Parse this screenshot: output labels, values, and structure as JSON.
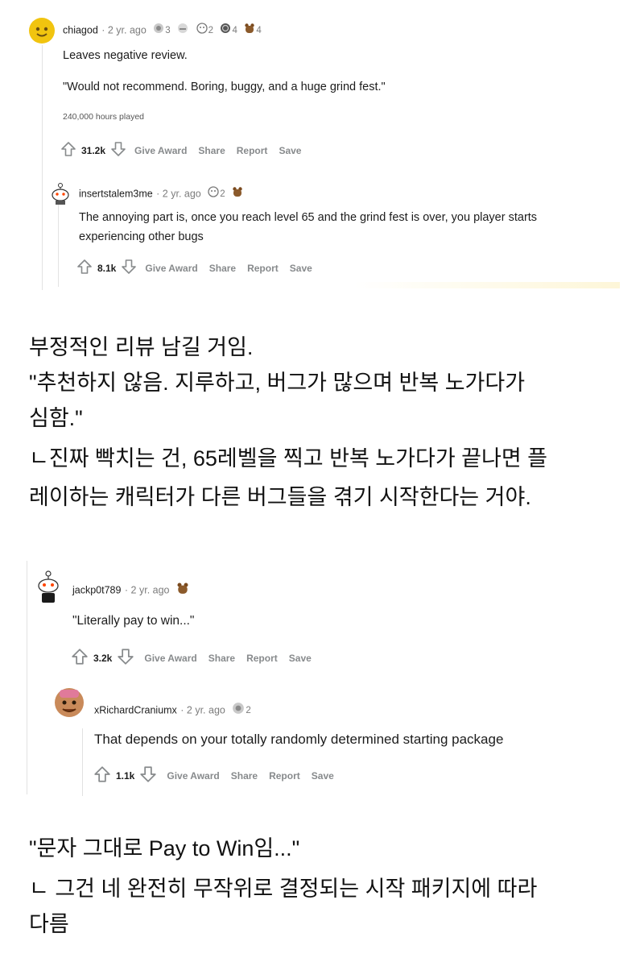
{
  "comment_1": {
    "username": "chiagod",
    "age": "· 2 yr. ago",
    "awards": [
      {
        "icon": "silver-hands-award-icon",
        "count": "3"
      },
      {
        "icon": "hug-award-icon",
        "count": ""
      },
      {
        "icon": "face-award-icon",
        "count": "2"
      },
      {
        "icon": "coin-award-icon",
        "count": "4"
      },
      {
        "icon": "bear-award-icon",
        "count": "4"
      }
    ],
    "line_1": "Leaves negative review.",
    "line_2": "\"Would not recommend. Boring, buggy, and a huge grind fest.\"",
    "line_3": "240,000 hours played",
    "votes": "31.2k",
    "actions": {
      "give_award": "Give Award",
      "share": "Share",
      "report": "Report",
      "save": "Save"
    }
  },
  "comment_2": {
    "username": "insertstalem3me",
    "age": "· 2 yr. ago",
    "awards": [
      {
        "icon": "face-award-icon",
        "count": "2"
      },
      {
        "icon": "bear-award-icon",
        "count": ""
      }
    ],
    "line_1": "The annoying part is, once you reach level 65 and the grind fest is over, you player starts",
    "line_2": "experiencing other bugs",
    "votes": "8.1k",
    "actions": {
      "give_award": "Give Award",
      "share": "Share",
      "report": "Report",
      "save": "Save"
    }
  },
  "caption_1": {
    "lines": [
      "부정적인 리뷰 남길 거임.",
      "\"추천하지 않음. 지루하고, 버그가 많으며 반복 노가다가",
      "심함.\"",
      "ㄴ진짜 빡치는 건, 65레벨을 찍고 반복 노가다가 끝나면 플",
      "레이하는 캐릭터가 다른 버그들을 겪기 시작한다는 거야."
    ]
  },
  "comment_3": {
    "username": "jackp0t789",
    "age": "· 2 yr. ago",
    "awards": [
      {
        "icon": "bear-award-icon",
        "count": ""
      }
    ],
    "line_1": "\"Literally pay to win...\"",
    "votes": "3.2k",
    "actions": {
      "give_award": "Give Award",
      "share": "Share",
      "report": "Report",
      "save": "Save"
    }
  },
  "comment_4": {
    "username": "xRichardCraniumx",
    "age": "· 2 yr. ago",
    "awards": [
      {
        "icon": "silver-hands-award-icon",
        "count": "2"
      }
    ],
    "line_1": "That depends on your totally randomly determined starting package",
    "votes": "1.1k",
    "actions": {
      "give_award": "Give Award",
      "share": "Share",
      "report": "Report",
      "save": "Save"
    }
  },
  "caption_2": {
    "lines": [
      "\"문자 그대로 Pay to Win임...\"",
      "ㄴ 그건 네 완전히 무작위로 결정되는 시작 패키지에 따라",
      "다름"
    ]
  }
}
